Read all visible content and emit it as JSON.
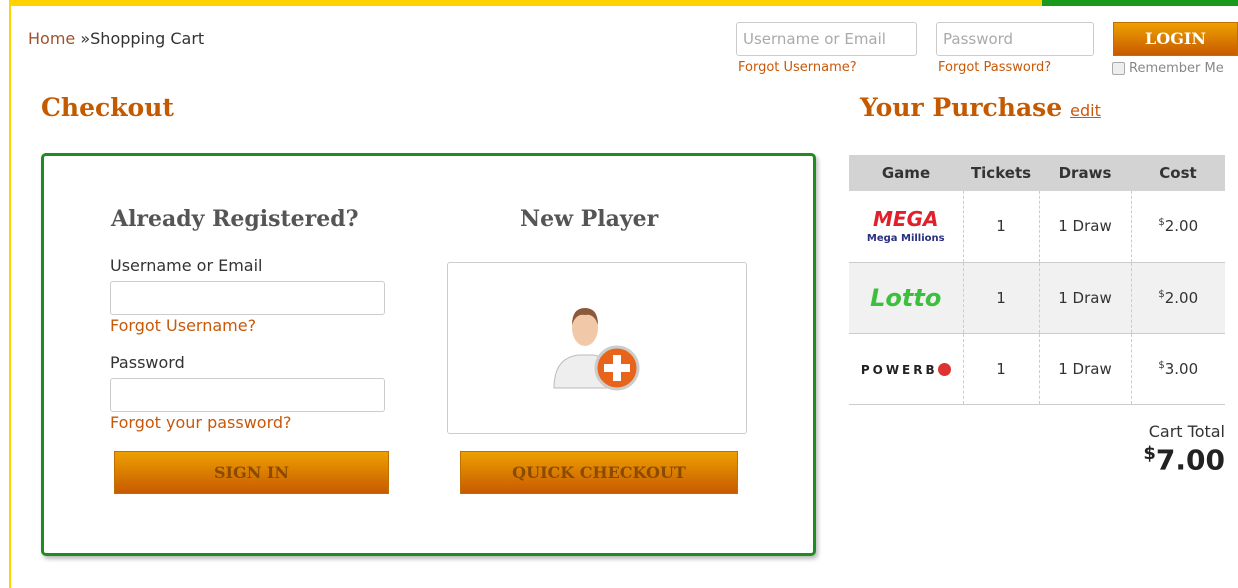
{
  "breadcrumb": {
    "home": "Home",
    "separator": "»",
    "current": "Shopping Cart"
  },
  "header_login": {
    "username_placeholder": "Username or Email",
    "password_placeholder": "Password",
    "login_label": "LOGIN",
    "forgot_username": "Forgot Username?",
    "forgot_password": "Forgot Password?",
    "remember_me": "Remember Me"
  },
  "checkout": {
    "title": "Checkout",
    "registered": {
      "heading": "Already Registered?",
      "username_label": "Username or Email",
      "forgot_username": "Forgot Username?",
      "password_label": "Password",
      "forgot_password": "Forgot your password?",
      "sign_in": "SIGN IN"
    },
    "new_player": {
      "heading": "New Player",
      "icon": "add-user-icon",
      "quick_checkout": "QUICK CHECKOUT"
    }
  },
  "purchase": {
    "title": "Your Purchase",
    "edit": "edit",
    "columns": [
      "Game",
      "Tickets",
      "Draws",
      "Cost"
    ],
    "rows": [
      {
        "game": "Mega Millions",
        "logo_text": "MEGA MILLIONS",
        "tickets": "1",
        "draws": "1 Draw",
        "currency": "$",
        "cost": "2.00"
      },
      {
        "game": "Lotto",
        "logo_text": "Lotto",
        "tickets": "1",
        "draws": "1 Draw",
        "currency": "$",
        "cost": "2.00"
      },
      {
        "game": "Powerball",
        "logo_text": "POWERB",
        "tickets": "1",
        "draws": "1 Draw",
        "currency": "$",
        "cost": "3.00"
      }
    ],
    "total_label": "Cart Total",
    "total_currency": "$",
    "total": "7.00"
  },
  "colors": {
    "accent": "#c8580a",
    "border_green": "#1f8c1f",
    "top_yellow": "#ffd200"
  }
}
